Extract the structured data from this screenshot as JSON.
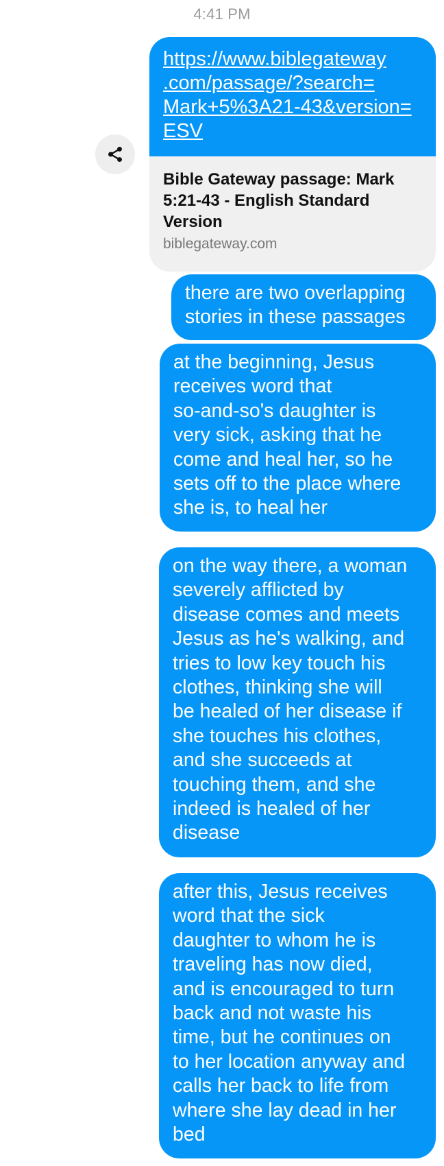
{
  "conversation": {
    "timestamp": "4:41 PM",
    "link_message": {
      "url": "https://www.biblegateway.com/passage/?search=Mark+5%3A21-43&version=ESV",
      "url_lines": [
        "https://www.biblegateway",
        ".com/passage/?search=",
        "Mark+5%3A21-43&version=",
        "ESV"
      ],
      "preview_title": "Bible Gateway passage: Mark 5:21-43 - English Standard Version",
      "preview_title_lines": [
        "Bible Gateway passage: Mark",
        "5:21-43 - English Standard",
        "Version"
      ],
      "preview_domain": "biblegateway.com",
      "share_icon": "share-icon"
    },
    "messages": [
      {
        "text": "there are two overlapping stories in these passages",
        "lines": [
          "there are two overlapping",
          "stories in these passages"
        ]
      },
      {
        "text": "at the beginning, Jesus receives word that so-and-so's daughter is very sick, asking that he come and heal her, so he sets off to the place where she is, to heal her",
        "lines": [
          "at the beginning, Jesus",
          "receives word that",
          "so-and-so's daughter is",
          "very sick, asking that he",
          "come and heal her, so he",
          "sets off to the place where",
          "she is, to heal her"
        ]
      },
      {
        "text": "on the way there, a woman severely afflicted by disease comes and meets Jesus as he's walking, and tries to low key touch his clothes, thinking she will be healed of her disease if she touches his clothes, and she succeeds at touching them, and she indeed is healed of her disease",
        "lines": [
          "on the way there, a woman",
          "severely afflicted by",
          "disease comes and meets",
          "Jesus as he's walking, and",
          "tries to low key touch his",
          "clothes, thinking she will",
          "be healed of her disease if",
          "she touches his clothes,",
          "and she succeeds at",
          "touching them, and she",
          "indeed is healed of her",
          "disease"
        ]
      },
      {
        "text": "after this, Jesus receives word that the sick daughter to whom he is traveling has now died, and is encouraged to turn back and not waste his time, but he continues on to her location anyway and calls her back to life from where she lay dead in her bed",
        "lines": [
          "after this, Jesus receives",
          "word that the sick",
          "daughter to whom he is",
          "traveling has now died,",
          "and is encouraged to turn",
          "back and not waste his",
          "time, but he continues on",
          "to her location anyway and",
          "calls her back to life from",
          "where she lay dead in her",
          "bed"
        ]
      }
    ],
    "colors": {
      "bubble": "#0696f8",
      "bubble_text": "#ffffff",
      "preview_bg": "#f0f0f0",
      "timestamp": "#9a9a9a"
    }
  }
}
